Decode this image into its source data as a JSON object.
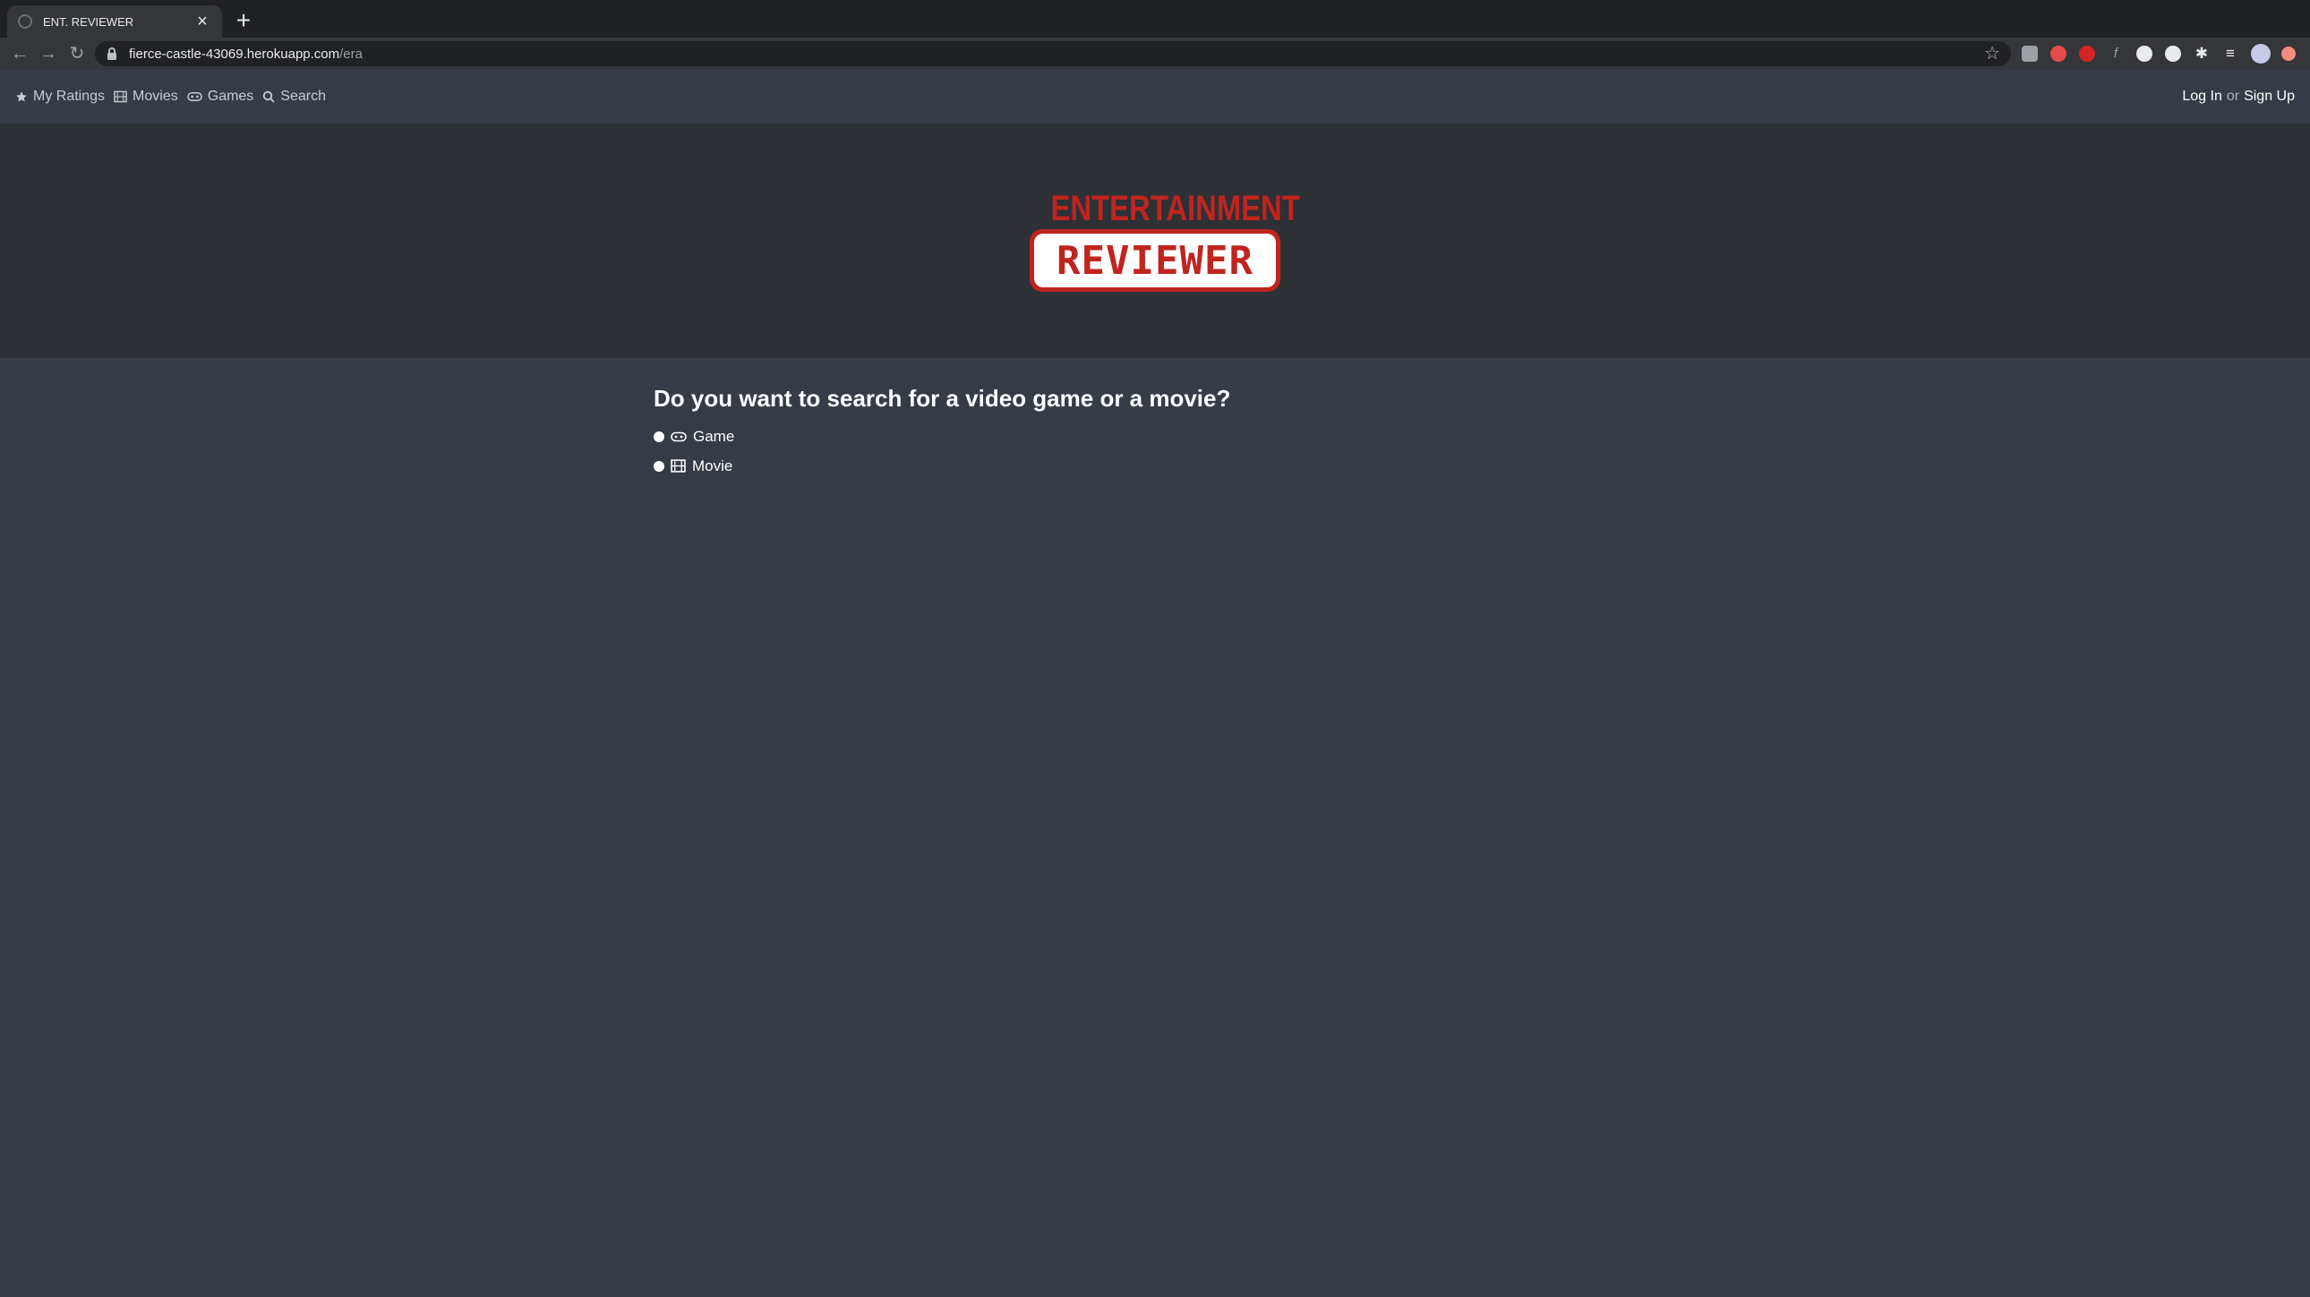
{
  "browser": {
    "tab_title": "ENT. REVIEWER",
    "new_tab_label": "+",
    "tab_close_label": "×",
    "url_host": "fierce-castle-43069.herokuapp.com",
    "url_path": "/era"
  },
  "site_nav": {
    "items": [
      {
        "label": "My Ratings",
        "icon": "star-icon"
      },
      {
        "label": "Movies",
        "icon": "film-icon"
      },
      {
        "label": "Games",
        "icon": "gamepad-icon"
      },
      {
        "label": "Search",
        "icon": "search-icon"
      }
    ],
    "login_label": "Log In",
    "or_label": "or",
    "signup_label": "Sign Up"
  },
  "logo": {
    "top_text": "ENTERTAINMENT",
    "bottom_text": "REVIEWER",
    "brand_color": "#c0241f"
  },
  "search_choice": {
    "question": "Do you want to search for a video game or a movie?",
    "options": [
      {
        "label": "Game",
        "icon": "gamepad-icon"
      },
      {
        "label": "Movie",
        "icon": "film-icon"
      }
    ]
  }
}
